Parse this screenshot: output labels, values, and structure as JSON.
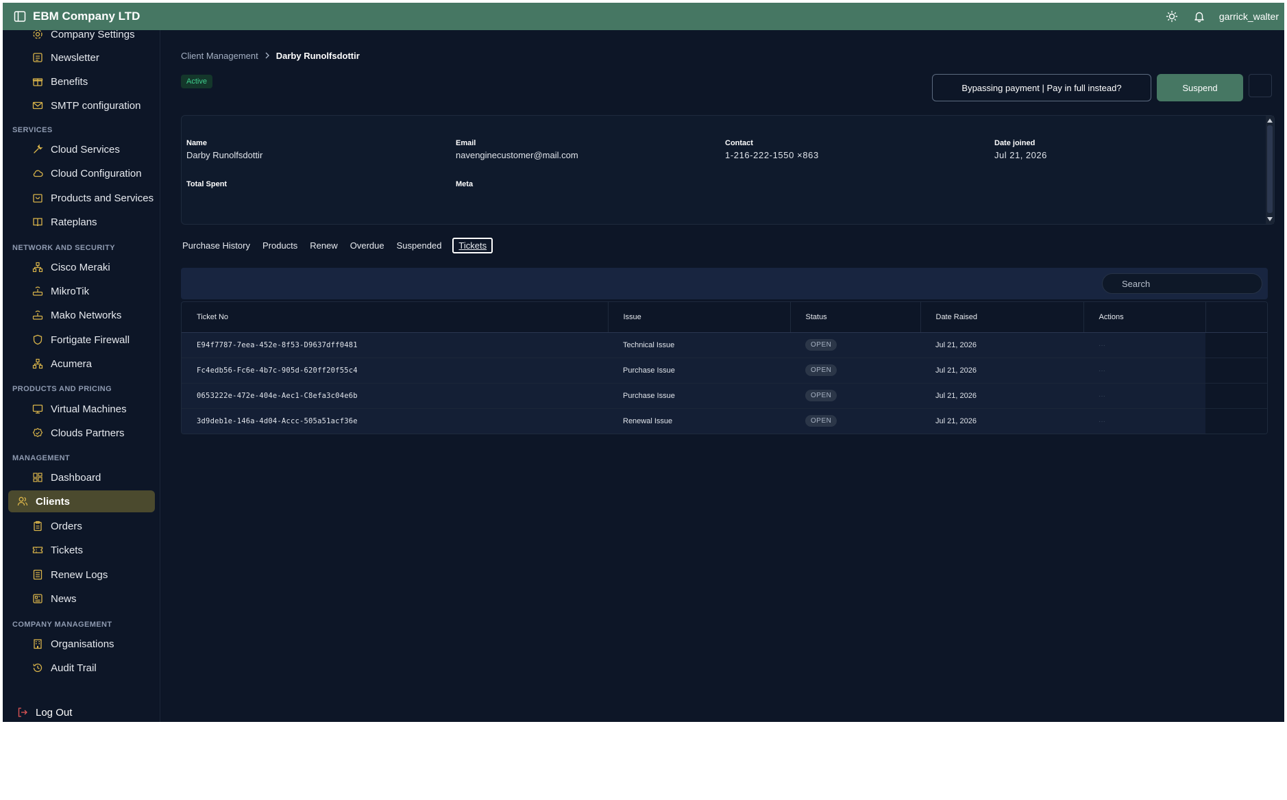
{
  "header": {
    "company": "EBM Company LTD",
    "user": "garrick_walter"
  },
  "sidebar": {
    "items_top": [
      {
        "label": "Company Settings",
        "icon": "gear-icon"
      },
      {
        "label": "Newsletter",
        "icon": "newsletter-icon"
      },
      {
        "label": "Benefits",
        "icon": "gift-icon"
      },
      {
        "label": "SMTP configuration",
        "icon": "mail-icon"
      }
    ],
    "sections": {
      "services": "SERVICES",
      "network": "NETWORK AND SECURITY",
      "products": "PRODUCTS AND PRICING",
      "management": "MANAGEMENT",
      "company": "COMPANY MANAGEMENT"
    },
    "services": [
      {
        "label": "Cloud Services"
      },
      {
        "label": "Cloud Configuration"
      },
      {
        "label": "Products and Services"
      },
      {
        "label": "Rateplans"
      }
    ],
    "network": [
      {
        "label": "Cisco Meraki"
      },
      {
        "label": "MikroTik"
      },
      {
        "label": "Mako Networks"
      },
      {
        "label": "Fortigate Firewall"
      },
      {
        "label": "Acumera"
      }
    ],
    "products": [
      {
        "label": "Virtual Machines"
      },
      {
        "label": "Clouds Partners"
      }
    ],
    "management": [
      {
        "label": "Dashboard"
      },
      {
        "label": "Clients"
      },
      {
        "label": "Orders"
      },
      {
        "label": "Tickets"
      },
      {
        "label": "Renew Logs"
      },
      {
        "label": "News"
      }
    ],
    "company": [
      {
        "label": "Organisations"
      },
      {
        "label": "Audit Trail"
      }
    ],
    "logout": "Log Out"
  },
  "breadcrumb": {
    "parent": "Client Management",
    "current": "Darby Runolfsdottir"
  },
  "status_badge": "Active",
  "actions": {
    "bypass": "Bypassing payment | Pay in full instead?",
    "suspend": "Suspend"
  },
  "client": {
    "name_label": "Name",
    "name": "Darby Runolfsdottir",
    "email_label": "Email",
    "email": "navenginecustomer@mail.com",
    "contact_label": "Contact",
    "contact": "1-216-222-1550 ×863",
    "joined_label": "Date joined",
    "joined": "Jul 21, 2026",
    "spent_label": "Total Spent",
    "meta_label": "Meta"
  },
  "tabs": [
    "Purchase History",
    "Products",
    "Renew",
    "Overdue",
    "Suspended",
    "Tickets"
  ],
  "search": {
    "placeholder": "Search"
  },
  "table": {
    "columns": [
      "Ticket No",
      "Issue",
      "Status",
      "Date Raised",
      "Actions"
    ],
    "rows": [
      {
        "ticket": "E94f7787-7eea-452e-8f53-D9637dff0481",
        "issue": "Technical Issue",
        "status": "OPEN",
        "date": "Jul 21, 2026"
      },
      {
        "ticket": "Fc4edb56-Fc6e-4b7c-905d-620ff20f55c4",
        "issue": "Purchase Issue",
        "status": "OPEN",
        "date": "Jul 21, 2026"
      },
      {
        "ticket": "0653222e-472e-404e-Aec1-C8efa3c04e6b",
        "issue": "Purchase Issue",
        "status": "OPEN",
        "date": "Jul 21, 2026"
      },
      {
        "ticket": "3d9deb1e-146a-4d04-Accc-505a51acf36e",
        "issue": "Renewal Issue",
        "status": "OPEN",
        "date": "Jul 21, 2026"
      }
    ]
  },
  "colors": {
    "topbar": "#467763",
    "background": "#0d1627",
    "active_nav": "#4b4a2e",
    "icon_gold": "#d9b44a",
    "logout_red": "#e05555"
  }
}
